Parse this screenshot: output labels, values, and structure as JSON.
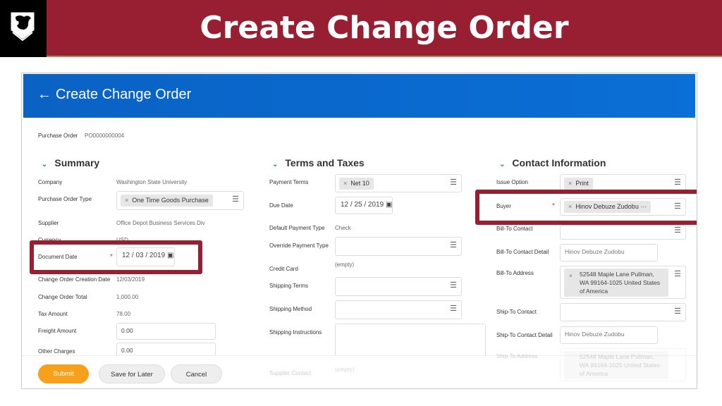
{
  "slide": {
    "title": "Create Change Order",
    "logo_text": "WSU"
  },
  "app": {
    "title": "Create Change Order",
    "back_icon": "arrow-left-icon",
    "header_color": "#0a68c8"
  },
  "purchase_order": {
    "label": "Purchase Order",
    "value": "PO0000000004"
  },
  "summary": {
    "title": "Summary",
    "company": {
      "label": "Company",
      "value": "Washington State University"
    },
    "po_type": {
      "label": "Purchase Order Type",
      "value": "One Time Goods Purchase"
    },
    "supplier": {
      "label": "Supplier",
      "value": "Office Depot Business Services Div"
    },
    "currency": {
      "label": "Currency",
      "value": "USD"
    },
    "document_date": {
      "label": "Document Date",
      "value": "12 / 03 / 2019"
    },
    "creation_date": {
      "label": "Change Order Creation Date",
      "value": "12/03/2019"
    },
    "total": {
      "label": "Change Order Total",
      "value": "1,000.00"
    },
    "tax": {
      "label": "Tax Amount",
      "value": "78.00"
    },
    "freight": {
      "label": "Freight Amount",
      "value": "0.00"
    },
    "other": {
      "label": "Other Charges",
      "value": "0.00"
    }
  },
  "terms": {
    "title": "Terms and Taxes",
    "payment_terms": {
      "label": "Payment Terms",
      "value": "Net 10"
    },
    "due_date": {
      "label": "Due Date",
      "value": "12 / 25 / 2019"
    },
    "default_payment": {
      "label": "Default Payment Type",
      "value": "Check"
    },
    "override_payment": {
      "label": "Override Payment Type",
      "value": ""
    },
    "credit_card": {
      "label": "Credit Card",
      "value": "(empty)"
    },
    "shipping_terms": {
      "label": "Shipping Terms",
      "value": ""
    },
    "shipping_method": {
      "label": "Shipping Method",
      "value": ""
    },
    "shipping_instructions": {
      "label": "Shipping Instructions",
      "value": ""
    },
    "supplier_contact": {
      "label": "Supplier Contact",
      "value": "(empty)"
    }
  },
  "contact": {
    "title": "Contact Information",
    "issue_option": {
      "label": "Issue Option",
      "value": "Print"
    },
    "buyer": {
      "label": "Buyer",
      "value": "Hinov Debuze Zudobu"
    },
    "bill_to_contact": {
      "label": "Bill-To Contact",
      "value": ""
    },
    "bill_to_contact_detail": {
      "label": "Bill-To Contact Detail",
      "value": "Hinov Debuze Zudobu"
    },
    "bill_to_address": {
      "label": "Bill-To Address",
      "value": "52548 Maple Lane Pullman, WA 99164-1025 United States of America"
    },
    "ship_to_contact": {
      "label": "Ship-To Contact",
      "value": ""
    },
    "ship_to_contact_detail": {
      "label": "Ship-To Contact Detail",
      "value": "Hinov Debuze Zudobu"
    },
    "ship_to_address": {
      "label": "Ship-To Address",
      "value": "52548 Maple Lane Pullman, WA 99164-1025 United States of America"
    }
  },
  "footer": {
    "submit": "Submit",
    "save": "Save for Later",
    "cancel": "Cancel",
    "submit_color": "#f7a11a"
  },
  "highlight_color": "#981e32"
}
